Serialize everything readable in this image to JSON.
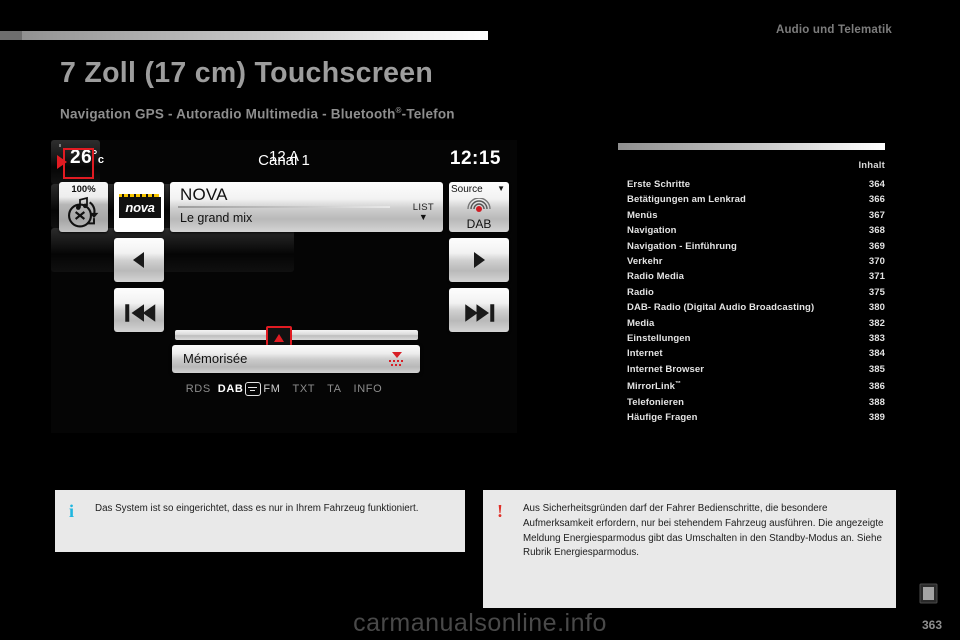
{
  "header": {
    "section": "Audio und Telematik"
  },
  "headings": {
    "title": "7 Zoll (17 cm) Touchscreen",
    "subtitle_pre": "Navigation GPS - Autoradio Multimedia - Bluetooth",
    "subtitle_sup": "®",
    "subtitle_post": "-Telefon"
  },
  "screen": {
    "temperature": "26",
    "degree": "°",
    "unit": "c",
    "clock": "12:15",
    "volume": "100%",
    "station_logo": "nova",
    "now_playing_title": "NOVA",
    "now_playing_subtitle": "Le grand mix",
    "list_label": "LIST",
    "list_caret": "▼",
    "source_label": "Source",
    "source_caret": "▼",
    "source_value": "DAB",
    "channel": "Canal 1",
    "frequency": "12 A",
    "preset_label": "Mémorisée",
    "tags": [
      "RDS",
      "DAB",
      "FM",
      "TXT",
      "TA",
      "INFO"
    ]
  },
  "toc": {
    "heading": "Inhalt",
    "entries": [
      {
        "title": "Erste Schritte",
        "page": "364"
      },
      {
        "title": "Betätigungen am Lenkrad",
        "page": "366"
      },
      {
        "title": "Menüs",
        "page": "367"
      },
      {
        "title": "Navigation",
        "page": "368"
      },
      {
        "title": "Navigation - Einführung",
        "page": "369"
      },
      {
        "title": "Verkehr",
        "page": "370"
      },
      {
        "title": "Radio Media",
        "page": "371"
      },
      {
        "title": "Radio",
        "page": "375"
      },
      {
        "title": "DAB- Radio (Digital Audio Broadcasting)",
        "page": "380"
      },
      {
        "title": "Media",
        "page": "382"
      },
      {
        "title": "Einstellungen",
        "page": "383"
      },
      {
        "title": "Internet",
        "page": "384"
      },
      {
        "title": "Internet Browser",
        "page": "385"
      },
      {
        "title": "MirrorLink",
        "page": "386",
        "sup": "™"
      },
      {
        "title": "Telefonieren",
        "page": "388"
      },
      {
        "title": "Häufige Fragen",
        "page": "389"
      }
    ]
  },
  "notes": {
    "info": {
      "icon": "i",
      "text": "Das System ist so eingerichtet, dass es nur in Ihrem Fahrzeug funktioniert."
    },
    "warning": {
      "icon": "!",
      "text": "Aus Sicherheitsgründen darf der Fahrer Bedienschritte, die besondere Aufmerksamkeit erfordern, nur bei stehendem Fahrzeug ausführen. Die angezeigte Meldung Energiesparmodus gibt das Umschalten in den Standby-Modus an. Siehe Rubrik Energiesparmodus."
    }
  },
  "footer": {
    "page_number": "363",
    "watermark": "carmanualsonline.info"
  }
}
